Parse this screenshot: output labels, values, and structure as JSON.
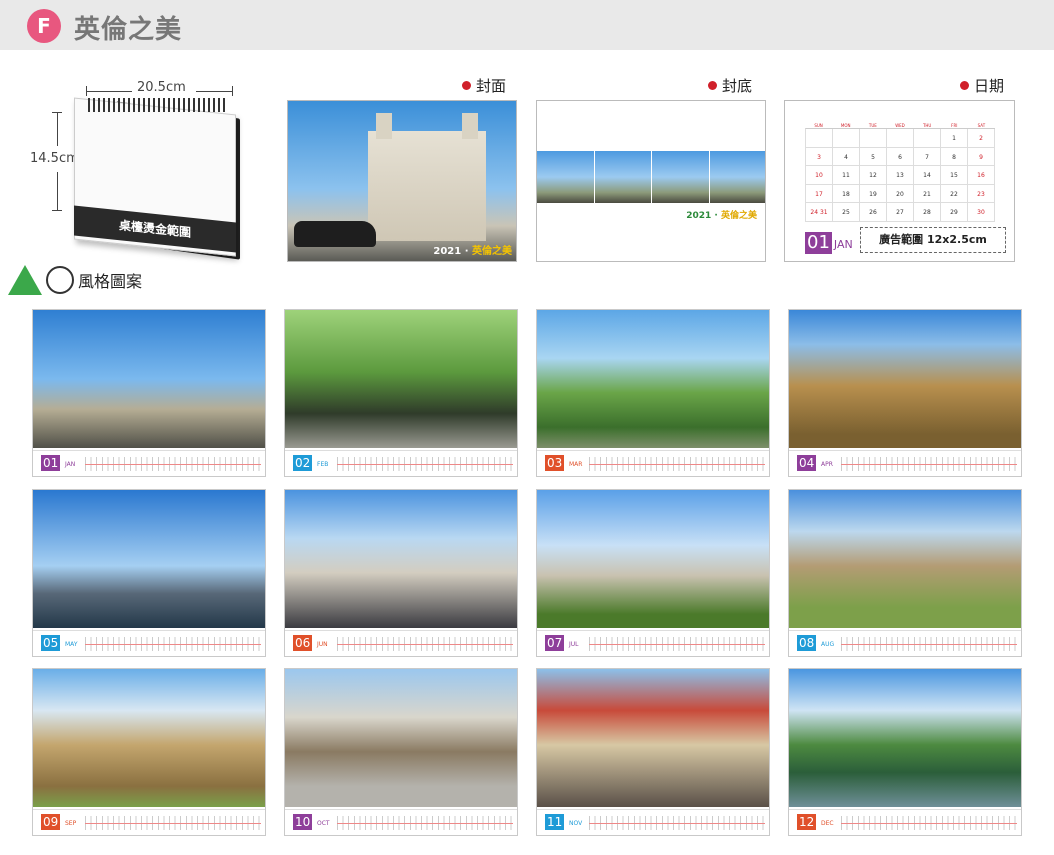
{
  "header": {
    "badge": "F",
    "title": "英倫之美"
  },
  "size": {
    "width_label": "20.5cm",
    "height_label": "14.5cm",
    "product_label": "桌檯燙金範圍"
  },
  "cover": {
    "heading": "封面",
    "year": "2021",
    "tagline": "英倫之美"
  },
  "back": {
    "heading": "封底",
    "year": "2021",
    "tagline": "英倫之美"
  },
  "date_page": {
    "heading": "日期",
    "weekdays": [
      "SUN",
      "MON",
      "TUE",
      "WED",
      "THU",
      "FRI",
      "SAT"
    ],
    "days": [
      "",
      "",
      "",
      "",
      "",
      "1",
      "2",
      "3",
      "4",
      "5",
      "6",
      "7",
      "8",
      "9",
      "10",
      "11",
      "12",
      "13",
      "14",
      "15",
      "16",
      "17",
      "18",
      "19",
      "20",
      "21",
      "22",
      "23",
      "24 31",
      "25",
      "26",
      "27",
      "28",
      "29",
      "30"
    ],
    "month_num": "01",
    "month_name": "JAN",
    "ad_area": "廣告範圍 12x2.5cm"
  },
  "style_section": {
    "label": "風格圖案"
  },
  "months": [
    {
      "num": "01",
      "name": "JAN",
      "color": "#8e3e9a"
    },
    {
      "num": "02",
      "name": "FEB",
      "color": "#1e9bd7"
    },
    {
      "num": "03",
      "name": "MAR",
      "color": "#e0502a"
    },
    {
      "num": "04",
      "name": "APR",
      "color": "#8e3e9a"
    },
    {
      "num": "05",
      "name": "MAY",
      "color": "#1e9bd7"
    },
    {
      "num": "06",
      "name": "JUN",
      "color": "#e0502a"
    },
    {
      "num": "07",
      "name": "JUL",
      "color": "#8e3e9a"
    },
    {
      "num": "08",
      "name": "AUG",
      "color": "#1e9bd7"
    },
    {
      "num": "09",
      "name": "SEP",
      "color": "#e0502a"
    },
    {
      "num": "10",
      "name": "OCT",
      "color": "#8e3e9a"
    },
    {
      "num": "11",
      "name": "NOV",
      "color": "#1e9bd7"
    },
    {
      "num": "12",
      "name": "DEC",
      "color": "#e0502a"
    }
  ]
}
